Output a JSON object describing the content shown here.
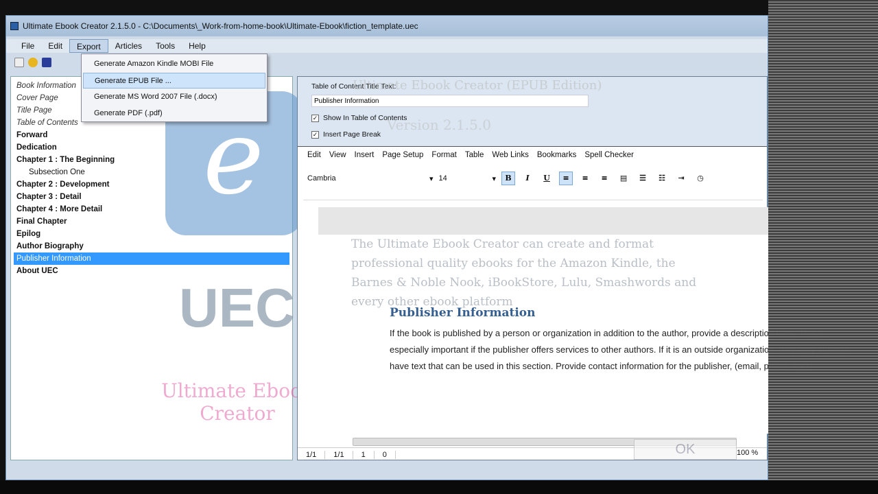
{
  "window": {
    "title": "Ultimate Ebook Creator 2.1.5.0 - C:\\Documents\\_Work-from-home-book\\Ultimate-Ebook\\fiction_template.uec"
  },
  "menubar": [
    "File",
    "Edit",
    "Export",
    "Articles",
    "Tools",
    "Help"
  ],
  "export_menu": [
    "Generate Amazon Kindle MOBI File",
    "Generate EPUB File ...",
    "Generate MS Word 2007 File (.docx)",
    "Generate PDF (.pdf)"
  ],
  "tree": [
    "Book Information",
    "Cover Page",
    "Title Page",
    "Table of Contents",
    "Forward",
    "Dedication",
    "Chapter 1 : The Beginning",
    "Subsection One",
    "Chapter 2 : Development",
    "Chapter 3 : Detail",
    "Chapter 4 : More Detail",
    "Final Chapter",
    "Epilog",
    "Author Biography",
    "Publisher Information",
    "About UEC"
  ],
  "props": {
    "label": "Table of Content Title Text:",
    "value": "Publisher Information",
    "show_toc": "Show In Table of Contents",
    "page_break": "Insert Page Break"
  },
  "editor_tabs": [
    "Edit",
    "View",
    "Insert",
    "Page Setup",
    "Format",
    "Table",
    "Web Links",
    "Bookmarks",
    "Spell Checker"
  ],
  "format": {
    "font": "Cambria",
    "size": "14",
    "buttons": [
      "B",
      "I",
      "U"
    ]
  },
  "content": {
    "heading": "Publisher Information",
    "paragraph": "If the book is published by a person or organization in addition to the author, provide a description here. This is especially important if the publisher offers services to other authors. If it is an outside organization, they may already have text that can be used in this section. Provide contact information for the publisher, (email, phone, etc)."
  },
  "splash": {
    "title": "Ultimate Ebook Creator (EPUB Edition)",
    "version": "Version 2.1.5.0",
    "logo_letter": "e",
    "logo_text": "UEC",
    "name": "Ultimate Ebook Creator",
    "blurb": "The Ultimate Ebook Creator can create and format professional quality ebooks for the Amazon Kindle, the Barnes & Noble Nook, iBookStore, Lulu, Smashwords and every other ebook platform",
    "ok": "OK"
  },
  "status": [
    "1/1",
    "1/1",
    "1",
    "0"
  ],
  "zoom": "100 %"
}
